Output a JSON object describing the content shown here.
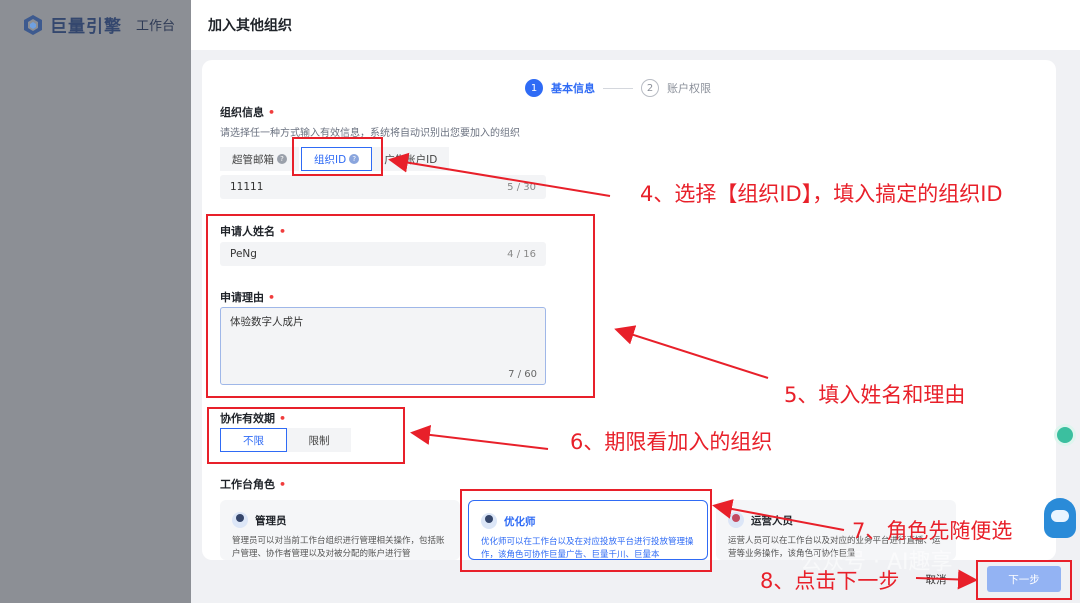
{
  "brand": {
    "name": "巨量引擎",
    "workspace": "工作台"
  },
  "drawer": {
    "title": "加入其他组织"
  },
  "steps": [
    {
      "index": "1",
      "label": "基本信息"
    },
    {
      "index": "2",
      "label": "账户权限"
    }
  ],
  "org_info": {
    "label": "组织信息",
    "hint": "请选择任一种方式输入有效信息，系统将自动识别出您要加入的组织",
    "options": [
      "超管邮箱",
      "组织ID",
      "广告账户ID"
    ],
    "value": "11111",
    "count": "5 / 30"
  },
  "applicant_name": {
    "label": "申请人姓名",
    "value": "PeNg",
    "count": "4 / 16"
  },
  "reason": {
    "label": "申请理由",
    "value": "体验数字人成片",
    "count": "7 / 60"
  },
  "validity": {
    "label": "协作有效期",
    "options": [
      "不限",
      "限制"
    ]
  },
  "roles": {
    "label": "工作台角色",
    "items": [
      {
        "name": "管理员",
        "desc": "管理员可以对当前工作台组织进行管理相关操作，包括账户管理、协作者管理以及对被分配的账户进行管"
      },
      {
        "name": "优化师",
        "desc": "优化师可以在工作台以及在对应投放平台进行投放管理操作，该角色可协作巨量广告、巨量千川、巨量本"
      },
      {
        "name": "运营人员",
        "desc": "运营人员可以在工作台以及对应的业务平台进行直播、运营等业务操作，该角色可协作巨量"
      }
    ]
  },
  "footer": {
    "cancel": "取消",
    "next": "下一步"
  },
  "annotations": {
    "a4": "4、选择【组织ID】，填入搞定的组织ID",
    "a5": "5、填入姓名和理由",
    "a6": "6、期限看加入的组织",
    "a7": "7、角色先随便选",
    "a8": "8、点击下一步"
  },
  "watermark": "公众号 · AI趣享",
  "colors": {
    "accent": "#2f6bf5",
    "annotation": "#e8202a",
    "required": "#f03d3d"
  }
}
